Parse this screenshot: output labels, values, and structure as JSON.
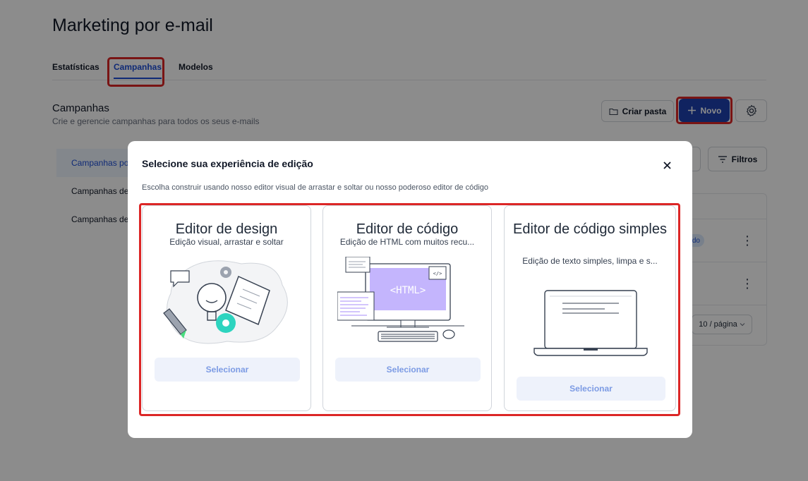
{
  "page": {
    "title": "Marketing por e-mail",
    "tabs": [
      "Estatísticas",
      "Campanhas",
      "Modelos"
    ],
    "section_title": "Campanhas",
    "section_subtitle": "Crie e gerencie campanhas para todos os seus e-mails",
    "create_folder_label": "Criar pasta",
    "new_label": "Novo",
    "filters_label": "Filtros",
    "sidebar": [
      "Campanhas por",
      "Campanhas de",
      "Campanhas de"
    ],
    "status_badge": "do",
    "per_page": "10 / página"
  },
  "modal": {
    "title": "Selecione sua experiência de edição",
    "description": "Escolha construir usando nosso editor visual de arrastar e soltar ou nosso poderoso editor de código",
    "cards": [
      {
        "title": "Editor de design",
        "subtitle": "Edição visual, arrastar e soltar",
        "button": "Selecionar"
      },
      {
        "title": "Editor de código",
        "subtitle": "Edição de HTML com muitos recu...",
        "button": "Selecionar",
        "illustration_text": "<HTML>"
      },
      {
        "title": "Editor de código simples",
        "subtitle": "Edição de texto simples, limpa e s...",
        "button": "Selecionar"
      }
    ]
  },
  "colors": {
    "primary": "#1e40af",
    "highlight": "#dc2626",
    "select_button_bg": "#eef2fb",
    "select_button_text": "#7c9be4",
    "html_screen": "#c4b5fd"
  },
  "icons": [
    "folder-icon",
    "plus-icon",
    "gear-icon",
    "filter-icon",
    "close-icon",
    "more-icon",
    "chevron-down-icon"
  ]
}
